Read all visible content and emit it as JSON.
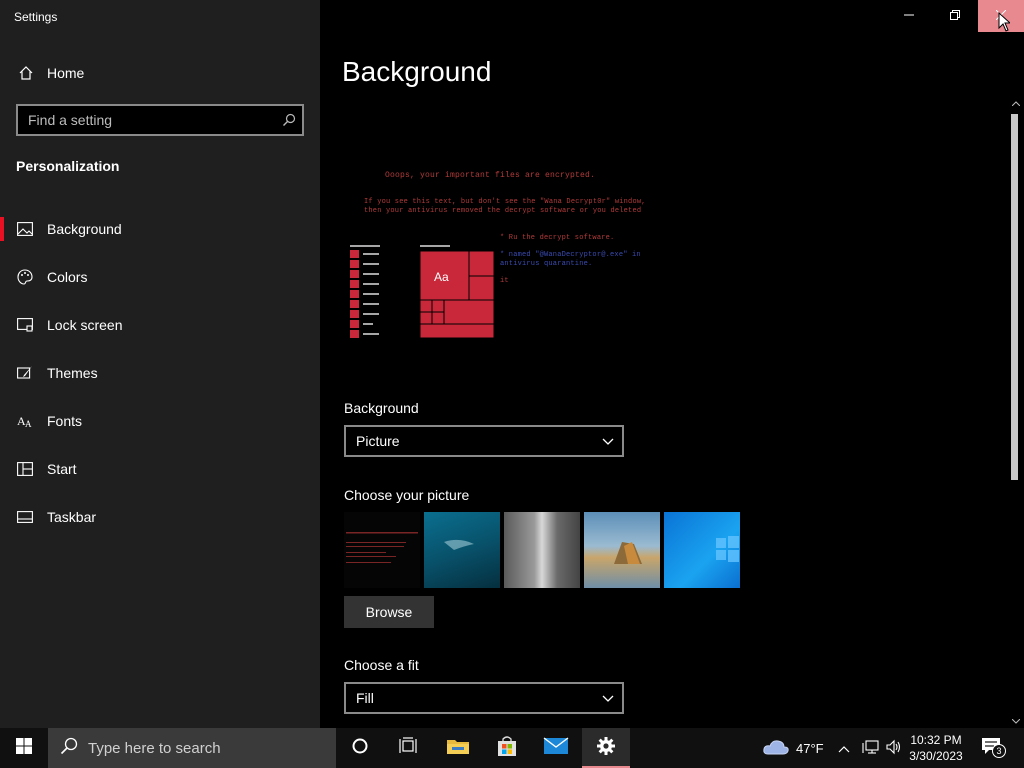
{
  "window": {
    "title": "Settings",
    "minimize_icon": "minimize-icon",
    "restore_icon": "restore-icon",
    "close_icon": "close-icon",
    "close_hover_color": "#e8888f"
  },
  "sidebar": {
    "home_label": "Home",
    "search_placeholder": "Find a setting",
    "section_title": "Personalization",
    "accent_color": "#e81123",
    "items": [
      {
        "label": "Background",
        "icon": "picture-icon",
        "active": true
      },
      {
        "label": "Colors",
        "icon": "palette-icon",
        "active": false
      },
      {
        "label": "Lock screen",
        "icon": "lock-screen-icon",
        "active": false
      },
      {
        "label": "Themes",
        "icon": "brush-icon",
        "active": false
      },
      {
        "label": "Fonts",
        "icon": "fonts-icon",
        "active": false
      },
      {
        "label": "Start",
        "icon": "start-icon",
        "active": false
      },
      {
        "label": "Taskbar",
        "icon": "taskbar-icon",
        "active": false
      }
    ]
  },
  "main": {
    "page_title": "Background",
    "preview": {
      "tile_text": "Aa",
      "tile_color": "#c8283a",
      "lines": [
        "Ooops, your important files are encrypted.",
        "If you see this text, but don't see the \"Wana Decrypt0r\" window,",
        "then your antivirus removed the decrypt software or you deleted",
        "* Ru the decrypt software.",
        "* named \"@WanaDecryptor@.exe\" in",
        "  antivirus quarantine.",
        "  it"
      ]
    },
    "background_label": "Background",
    "background_value": "Picture",
    "choose_picture_label": "Choose your picture",
    "browse_label": "Browse",
    "fit_label": "Choose a fit",
    "fit_value": "Fill"
  },
  "taskbar": {
    "search_placeholder": "Type here to search",
    "temperature": "47°F",
    "time": "10:32 PM",
    "date": "3/30/2023",
    "notification_count": "3",
    "active_indicator_color": "#e8888f"
  }
}
